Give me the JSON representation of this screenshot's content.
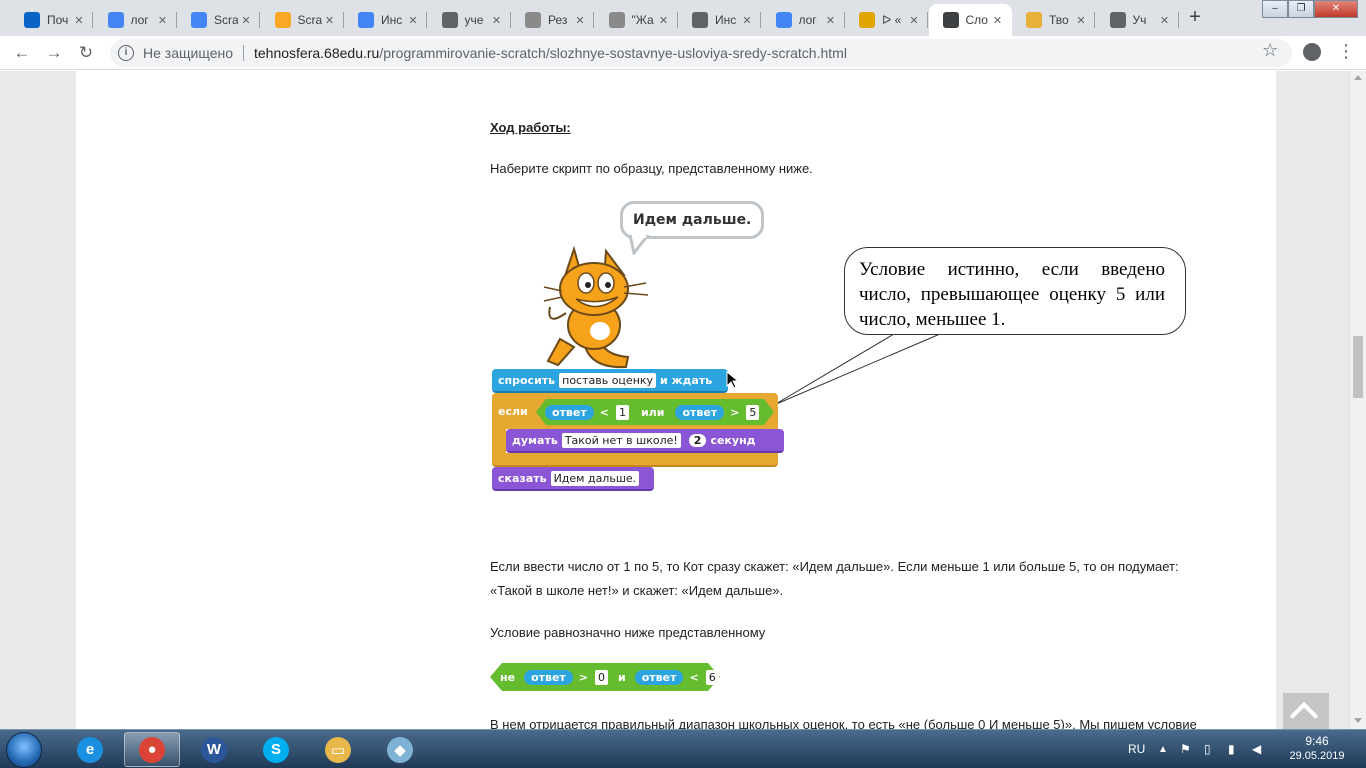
{
  "window": {
    "tabs": [
      {
        "label": "Поч",
        "icon": "outlook-icon",
        "color": "#0a64c8"
      },
      {
        "label": "лог",
        "icon": "google-icon",
        "color": "#4285f4"
      },
      {
        "label": "Scra",
        "icon": "google-icon",
        "color": "#4285f4"
      },
      {
        "label": "Scra",
        "icon": "scratch-icon",
        "color": "#f9a825"
      },
      {
        "label": "Инс",
        "icon": "google-icon",
        "color": "#4285f4"
      },
      {
        "label": "уче",
        "icon": "globe-icon",
        "color": "#5f6368"
      },
      {
        "label": "Рез",
        "icon": "site-icon",
        "color": "#8a8a8a"
      },
      {
        "label": "\"Жа",
        "icon": "site-icon",
        "color": "#8a8a8a"
      },
      {
        "label": "Инс",
        "icon": "globe-icon",
        "color": "#5f6368"
      },
      {
        "label": "лог",
        "icon": "google-icon",
        "color": "#4285f4"
      },
      {
        "label": "ᐅ «",
        "icon": "shield-icon",
        "color": "#e0a500"
      },
      {
        "label": "Сло",
        "icon": "gear-icon",
        "color": "#3c4043",
        "active": true
      },
      {
        "label": "Тво",
        "icon": "certificate-icon",
        "color": "#e8b23a"
      },
      {
        "label": "Уч",
        "icon": "globe-icon",
        "color": "#5f6368"
      }
    ],
    "controls": {
      "minimize": "–",
      "maximize": "❐",
      "close": "✕"
    }
  },
  "address_bar": {
    "security_label": "Не защищено",
    "host": "tehnosfera.68edu.ru",
    "path": "/programmirovanie-scratch/slozhnye-sostavnye-usloviya-sredy-scratch.html"
  },
  "content": {
    "heading": "Ход работы:",
    "intro": "Наберите скрипт по образцу, представленному ниже.",
    "speech_bubble": "Идем дальше.",
    "callout_text": "Условие истинно, если введено число, превышающее оценку 5 или число, меньшее 1.",
    "script": {
      "ask_label": "спросить",
      "ask_value": "поставь оценку",
      "ask_wait": "и ждать",
      "if_label": "если",
      "answer_label": "ответ",
      "lt": "<",
      "gt": ">",
      "value_1": "1",
      "or_label": "или",
      "value_5": "5",
      "think_label": "думать",
      "think_value": "Такой нет в школе!",
      "think_secs": "2",
      "secs_label": "секунд",
      "say_label": "сказать",
      "say_value": "Идем дальше."
    },
    "para1_line1": "Если ввести число от 1 по 5, то Кот  сразу скажет: «Идем дальше». Если меньше 1 или больше 5, то он подумает:",
    "para1_line2": "«Такой в школе нет!» и скажет: «Идем дальше».",
    "para2": "Условие  равнозначно  ниже представленному",
    "not_block": {
      "not_label": "не",
      "answer_label": "ответ",
      "gt": ">",
      "value_0": "0",
      "and_label": "и",
      "lt": "<",
      "value_6": "6"
    },
    "para3": "В нем отрицается правильный диапазон школьных оценок, то есть «не (больше 0 И меньше 5)». Мы пишем условие"
  },
  "taskbar": {
    "apps": [
      {
        "name": "internet-explorer",
        "glyph": "e",
        "color": "#1b8fe0"
      },
      {
        "name": "chrome",
        "glyph": "●",
        "color": "#db4437",
        "active": true
      },
      {
        "name": "word",
        "glyph": "W",
        "color": "#2b579a"
      },
      {
        "name": "skype",
        "glyph": "S",
        "color": "#00aff0"
      },
      {
        "name": "explorer",
        "glyph": "▭",
        "color": "#e8b84a"
      },
      {
        "name": "notes",
        "glyph": "◆",
        "color": "#7fb3d5"
      }
    ],
    "lang": "RU",
    "time": "9:46",
    "date": "29.05.2019"
  }
}
